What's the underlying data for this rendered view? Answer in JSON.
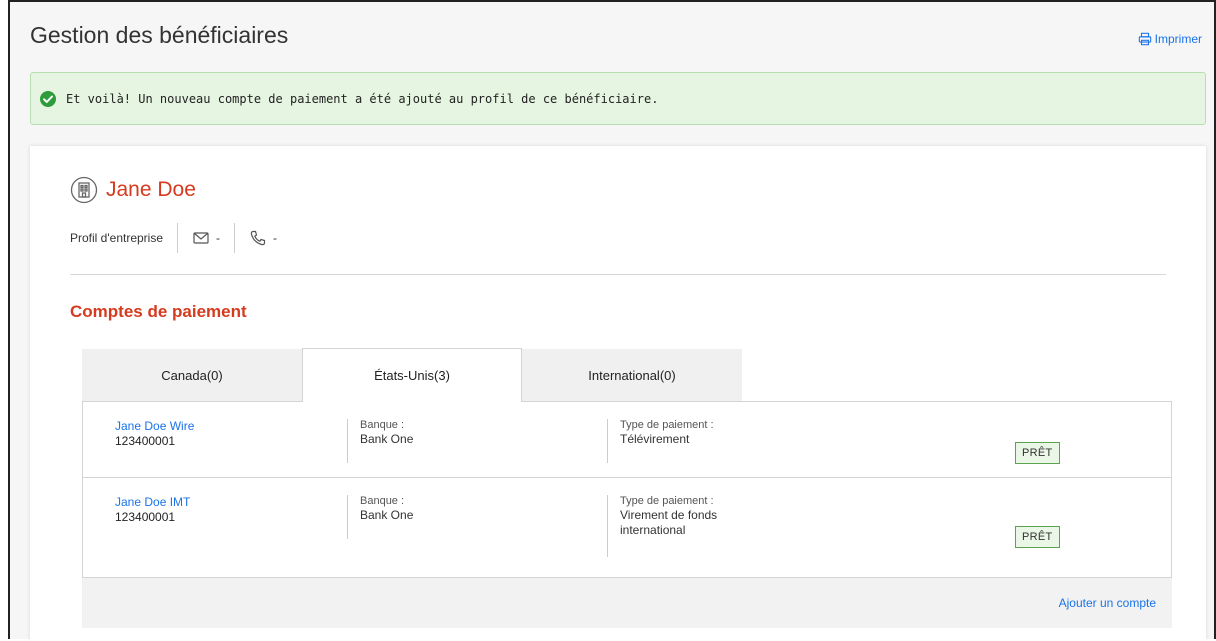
{
  "page": {
    "title": "Gestion des bénéficiaires",
    "print_label": "Imprimer"
  },
  "alert": {
    "message": "Et voilà! Un nouveau compte de paiement a été ajouté au profil de ce bénéficiaire.",
    "color": "#e6f5e1"
  },
  "profile": {
    "name": "Jane Doe",
    "type": "Profil d'entreprise",
    "email": "-",
    "phone": "-"
  },
  "section": {
    "title": "Comptes de paiement"
  },
  "tabs": [
    {
      "label": "Canada(0)",
      "active": false
    },
    {
      "label": "États-Unis(3)",
      "active": true
    },
    {
      "label": "International(0)",
      "active": false
    }
  ],
  "accounts": [
    {
      "name": "Jane Doe Wire",
      "number": "123400001",
      "bank_label": "Banque :",
      "bank": "Bank One",
      "type_label": "Type de paiement :",
      "type": "Télévirement",
      "status": "PRÊT"
    },
    {
      "name": "Jane Doe IMT",
      "number": "123400001",
      "bank_label": "Banque :",
      "bank": "Bank One",
      "type_label": "Type de paiement :",
      "type": "Virement de fonds international",
      "status": "PRÊT"
    }
  ],
  "footer": {
    "add_label": "Ajouter un compte"
  },
  "colors": {
    "accent_red": "#d63b1f",
    "link_blue": "#1a73e8",
    "success_green": "#2e9b3c"
  }
}
